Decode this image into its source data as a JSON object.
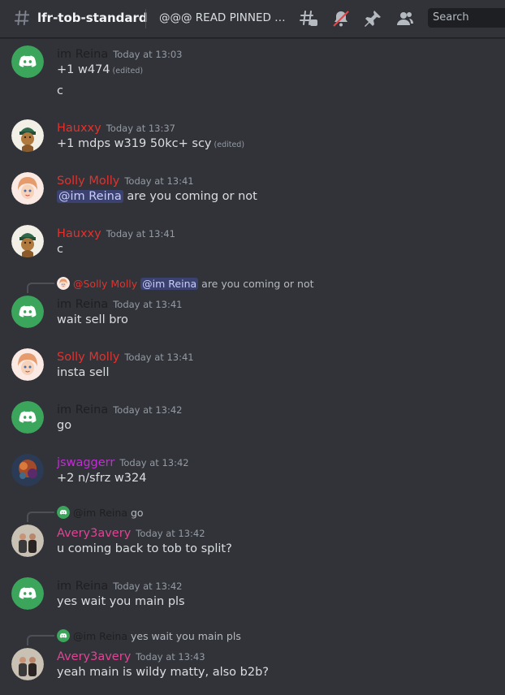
{
  "header": {
    "channel_name": "lfr-tob-standard",
    "topic": "@@@ READ PINNED ME...",
    "search_placeholder": "Search"
  },
  "colors": {
    "background": "#313338",
    "reina": "#1e1f22",
    "hauxxy": "#e0332f",
    "solly": "#e0332f",
    "jswaggerr": "#c72bd9",
    "avery": "#e04494",
    "discord_green": "#3ba55c",
    "mention_bg": "#3c4270"
  },
  "messages": {
    "m1": {
      "author": "im Reina",
      "time": "Today at 13:03",
      "text": "+1 w474",
      "edited": "(edited)",
      "text2": "c"
    },
    "m2": {
      "author": "Hauxxy",
      "time": "Today at 13:37",
      "text": "+1 mdps w319 50kc+ scy",
      "edited": "(edited)"
    },
    "m3": {
      "author": "Solly Molly",
      "time": "Today at 13:41",
      "mention": "@im Reina",
      "text": "are you coming or not"
    },
    "m4": {
      "author": "Hauxxy",
      "time": "Today at 13:41",
      "text": "c"
    },
    "m5": {
      "reply_author": "@Solly Molly",
      "reply_mention": "@im Reina",
      "reply_text": "are you coming or not",
      "author": "im Reina",
      "time": "Today at 13:41",
      "text": "wait sell bro"
    },
    "m6": {
      "author": "Solly Molly",
      "time": "Today at 13:41",
      "text": "insta sell"
    },
    "m7": {
      "author": "im Reina",
      "time": "Today at 13:42",
      "text": "go"
    },
    "m8": {
      "author": "jswaggerr",
      "time": "Today at 13:42",
      "text": "+2 n/sfrz w324"
    },
    "m9": {
      "reply_author": "@im Reina",
      "reply_text": "go",
      "author": "Avery3avery",
      "time": "Today at 13:42",
      "text": "u coming back to tob to split?"
    },
    "m10": {
      "author": "im Reina",
      "time": "Today at 13:42",
      "text": "yes wait you main pls"
    },
    "m11": {
      "reply_author": "@im Reina",
      "reply_text": "yes wait you main pls",
      "author": "Avery3avery",
      "time": "Today at 13:43",
      "text": "yeah main is wildy matty, also b2b?"
    }
  }
}
